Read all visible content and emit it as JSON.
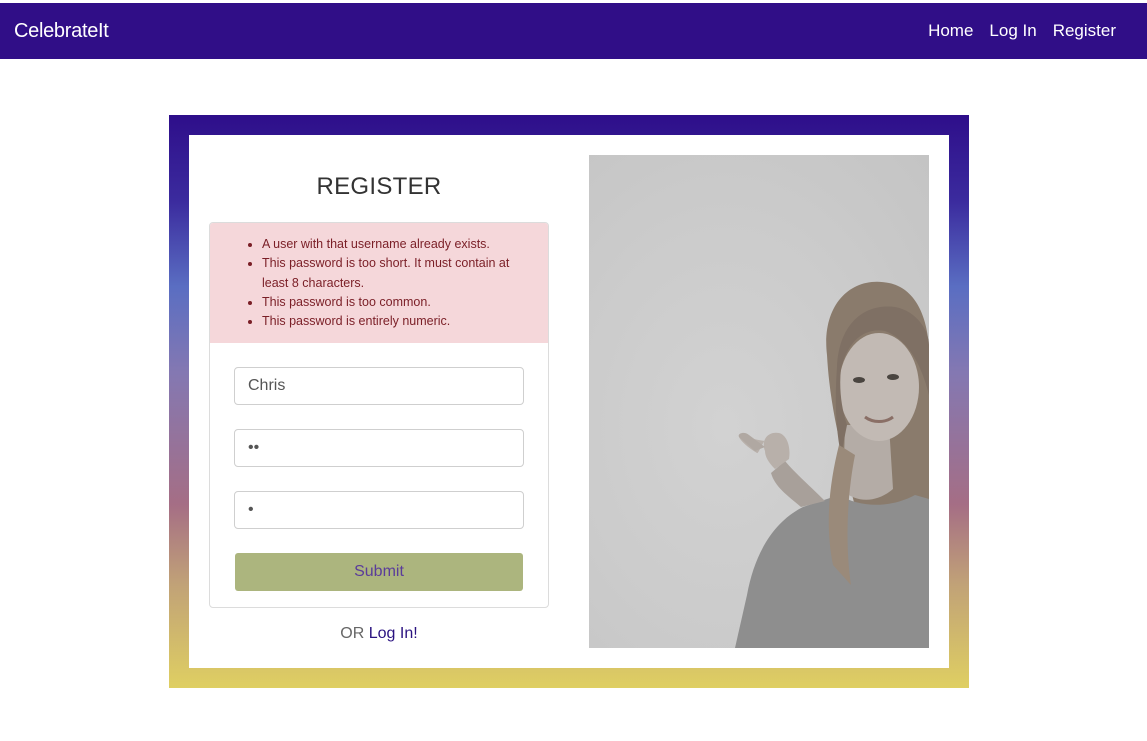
{
  "navbar": {
    "brand": "CelebrateIt",
    "links": [
      "Home",
      "Log In",
      "Register"
    ],
    "bg_color": "#300e87"
  },
  "form": {
    "title": "REGISTER",
    "errors": [
      "A user with that username already exists.",
      "This password is too short. It must contain at least 8 characters.",
      "This password is too common.",
      "This password is entirely numeric."
    ],
    "username_value": "Chris",
    "password_value": "12",
    "password_confirm_value": "1",
    "submit_label": "Submit",
    "alt_prefix": "OR",
    "alt_link": "Log In!"
  },
  "colors": {
    "alert_bg": "#f5d7da",
    "submit_bg": "#acb57e",
    "frame_gradient": [
      "#2e0e8a",
      "#5a6ec2",
      "#a56e85",
      "#dfcf62"
    ]
  }
}
